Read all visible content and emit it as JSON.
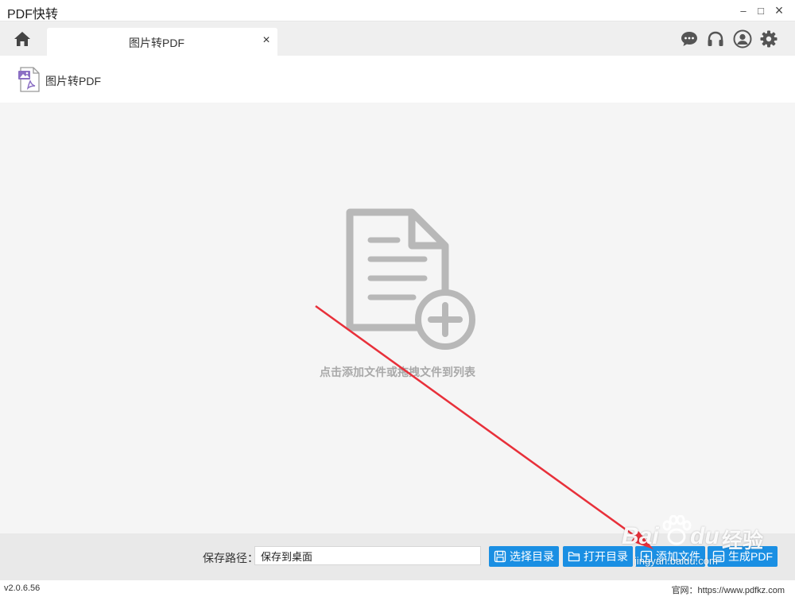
{
  "app": {
    "title": "PDF快转"
  },
  "window_controls": {
    "minimize": "–",
    "maximize": "□",
    "close": "×"
  },
  "tab": {
    "label": "图片转PDF",
    "close": "×"
  },
  "top_icons": [
    "chat-icon",
    "headset-icon",
    "user-icon",
    "gear-icon"
  ],
  "subheader": {
    "label": "图片转PDF"
  },
  "dropzone": {
    "hint": "点击添加文件或拖拽文件到列表"
  },
  "bottom": {
    "path_label": "保存路径：",
    "path_value": "保存到桌面",
    "buttons": {
      "select_dir": "选择目录",
      "open_dir": "打开目录",
      "add_file": "添加文件",
      "generate": "生成PDF"
    }
  },
  "status": {
    "version": "v2.0.6.56",
    "website": "官网：https://www.pdfkz.com"
  },
  "watermark": {
    "brand": "Bai",
    "brand2": "du",
    "cn": "经验",
    "url": "jingyan.baidu.com"
  },
  "colors": {
    "accent": "#1a8fe3",
    "annotation_arrow": "#e8303a",
    "hint": "#a9a9a9"
  }
}
